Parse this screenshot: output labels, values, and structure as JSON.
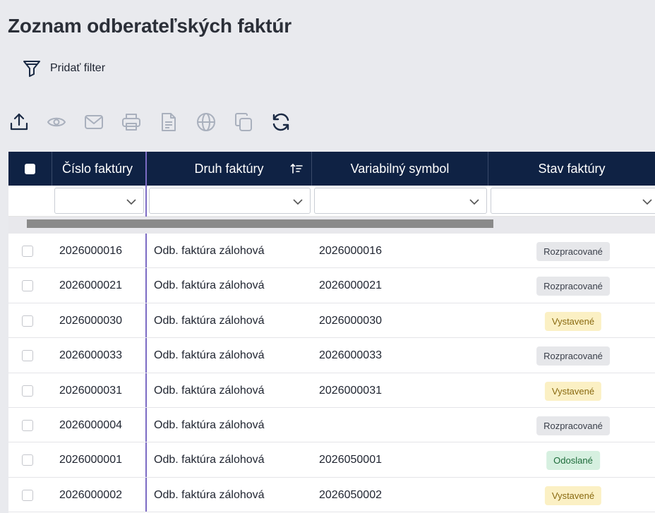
{
  "title": "Zoznam odberateľských faktúr",
  "filter": {
    "label": "Pridať filter",
    "icon": "funnel-icon"
  },
  "toolbar": [
    {
      "name": "export-icon",
      "active": true
    },
    {
      "name": "eye-icon",
      "active": false
    },
    {
      "name": "mail-icon",
      "active": false
    },
    {
      "name": "printer-icon",
      "active": false
    },
    {
      "name": "document-icon",
      "active": false
    },
    {
      "name": "globe-icon",
      "active": false
    },
    {
      "name": "copy-icon",
      "active": false
    },
    {
      "name": "refresh-icon",
      "active": true
    }
  ],
  "columns": {
    "c1": "Číslo faktúry",
    "c2": "Druh faktúry",
    "c3": "Variabilný symbol",
    "c4": "Stav faktúry"
  },
  "rows": [
    {
      "cislo": "2026000016",
      "druh": "Odb. faktúra zálohová",
      "vs": "2026000016",
      "stav": "Rozpracované",
      "stav_type": "gray"
    },
    {
      "cislo": "2026000021",
      "druh": "Odb. faktúra zálohová",
      "vs": "2026000021",
      "stav": "Rozpracované",
      "stav_type": "gray"
    },
    {
      "cislo": "2026000030",
      "druh": "Odb. faktúra zálohová",
      "vs": "2026000030",
      "stav": "Vystavené",
      "stav_type": "yellow"
    },
    {
      "cislo": "2026000033",
      "druh": "Odb. faktúra zálohová",
      "vs": "2026000033",
      "stav": "Rozpracované",
      "stav_type": "gray"
    },
    {
      "cislo": "2026000031",
      "druh": "Odb. faktúra zálohová",
      "vs": "2026000031",
      "stav": "Vystavené",
      "stav_type": "yellow"
    },
    {
      "cislo": "2026000004",
      "druh": "Odb. faktúra zálohová",
      "vs": "",
      "stav": "Rozpracované",
      "stav_type": "gray"
    },
    {
      "cislo": "2026000001",
      "druh": "Odb. faktúra zálohová",
      "vs": "2026050001",
      "stav": "Odoslané",
      "stav_type": "green"
    },
    {
      "cislo": "2026000002",
      "druh": "Odb. faktúra zálohová",
      "vs": "2026050002",
      "stav": "Vystavené",
      "stav_type": "yellow"
    }
  ],
  "colors": {
    "header_bg": "#0f2244",
    "accent_divider": "#7c6bc4",
    "icon_active": "#1b2a44",
    "icon_disabled": "#a9b0bd"
  }
}
